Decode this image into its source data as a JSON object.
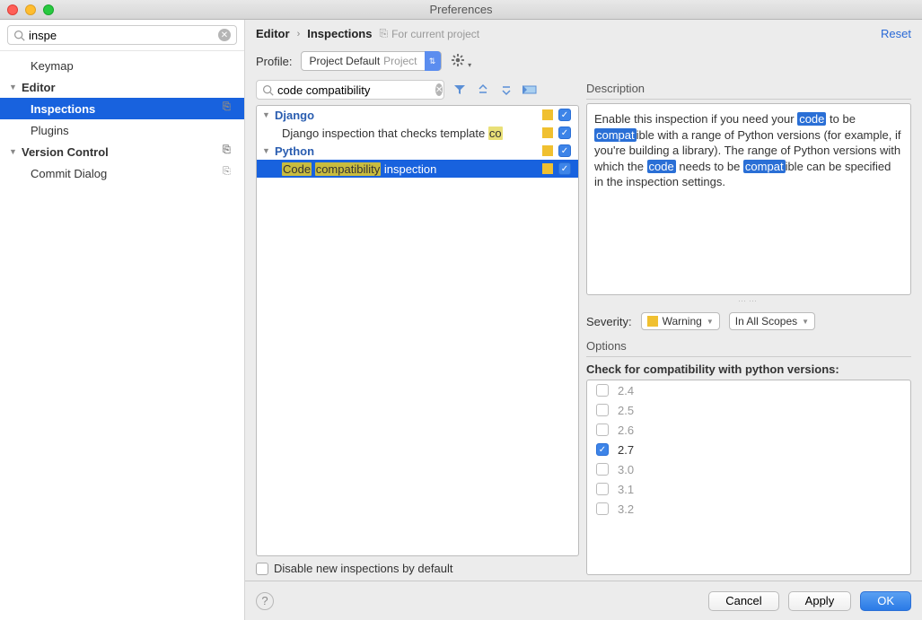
{
  "window_title": "Preferences",
  "sidebar_search": "inspe",
  "sidebar": {
    "keymap": "Keymap",
    "editor": "Editor",
    "inspections": "Inspections",
    "plugins": "Plugins",
    "version_control": "Version Control",
    "commit_dialog": "Commit Dialog"
  },
  "breadcrumb": {
    "editor": "Editor",
    "inspections": "Inspections",
    "for_project": "For current project",
    "reset": "Reset"
  },
  "profile": {
    "label": "Profile:",
    "name": "Project Default",
    "scope": "Project"
  },
  "filter_search": "code compatibility",
  "inspection_tree": {
    "django": "Django",
    "django_item": "Django inspection that checks template ",
    "django_item_hl": "co",
    "python": "Python",
    "py_item_hl1": "Code",
    "py_item_hl2": "compatibility",
    "py_item_rest": " inspection"
  },
  "disable_new": "Disable new inspections by default",
  "description": {
    "title": "Description",
    "p1a": "Enable this inspection if you need your ",
    "p1_code": "code",
    "p1b": " to be ",
    "p1_compat": "compat",
    "p1c": "ible with a range of Python versions (for example, if you're building a library). The range of Python versions with which the ",
    "p2_code": "code",
    "p1d": " needs to be ",
    "p2_compat": "compat",
    "p1e": "ible can be specified in the inspection settings."
  },
  "severity": {
    "label": "Severity:",
    "value": "Warning",
    "scope": "In All Scopes"
  },
  "options": {
    "title": "Options",
    "subtitle": "Check for compatibility with python versions:",
    "versions": [
      "2.4",
      "2.5",
      "2.6",
      "2.7",
      "3.0",
      "3.1",
      "3.2"
    ],
    "checked": "2.7"
  },
  "footer": {
    "cancel": "Cancel",
    "apply": "Apply",
    "ok": "OK"
  }
}
